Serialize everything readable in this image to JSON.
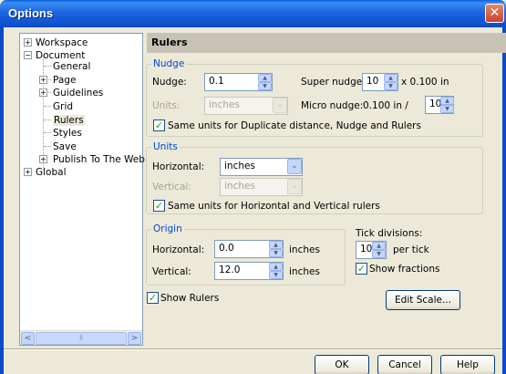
{
  "window": {
    "title": "Options",
    "close_glyph": "✕"
  },
  "tree": {
    "items": [
      {
        "label": "Workspace",
        "expander": "+"
      },
      {
        "label": "Document",
        "expander": "−"
      },
      {
        "label": "General"
      },
      {
        "label": "Page",
        "expander": "+"
      },
      {
        "label": "Guidelines",
        "expander": "+"
      },
      {
        "label": "Grid"
      },
      {
        "label": "Rulers",
        "selected": true
      },
      {
        "label": "Styles"
      },
      {
        "label": "Save"
      },
      {
        "label": "Publish To The Web",
        "expander": "+"
      },
      {
        "label": "Global",
        "expander": "+"
      }
    ]
  },
  "panel": {
    "title": "Rulers"
  },
  "nudge": {
    "legend": "Nudge",
    "nudge_label": "Nudge:",
    "nudge_value": "0.1",
    "super_label": "Super nudge:",
    "super_value": "10",
    "super_suffix": "x 0.100 in",
    "units_label": "Units:",
    "units_value": "inches",
    "micro_label": "Micro nudge:",
    "micro_prefix": "0.100 in /",
    "micro_value": "10",
    "same_units_label": "Same units for Duplicate distance, Nudge and Rulers"
  },
  "units": {
    "legend": "Units",
    "horizontal_label": "Horizontal:",
    "horizontal_value": "inches",
    "vertical_label": "Vertical:",
    "vertical_value": "inches",
    "same_units_label": "Same units for Horizontal and Vertical rulers"
  },
  "origin": {
    "legend": "Origin",
    "horizontal_label": "Horizontal:",
    "horizontal_value": "0.0",
    "horizontal_unit": "inches",
    "vertical_label": "Vertical:",
    "vertical_value": "12.0",
    "vertical_unit": "inches"
  },
  "tick": {
    "label": "Tick divisions:",
    "value": "10",
    "suffix": "per tick",
    "show_fractions_label": "Show fractions"
  },
  "show_rulers_label": "Show Rulers",
  "buttons": {
    "edit_scale": "Edit Scale...",
    "ok": "OK",
    "cancel": "Cancel",
    "help": "Help"
  },
  "icons": {
    "check": "✓",
    "spin_up": "▲",
    "spin_down": "▼",
    "dropdown": "⌄",
    "scroll_left": "<",
    "scroll_right": ">",
    "thumb_grip": "⦀"
  },
  "colors": {
    "group_label": "#0046d5",
    "title_bar": "#0a4cc9",
    "check": "#21a121"
  }
}
